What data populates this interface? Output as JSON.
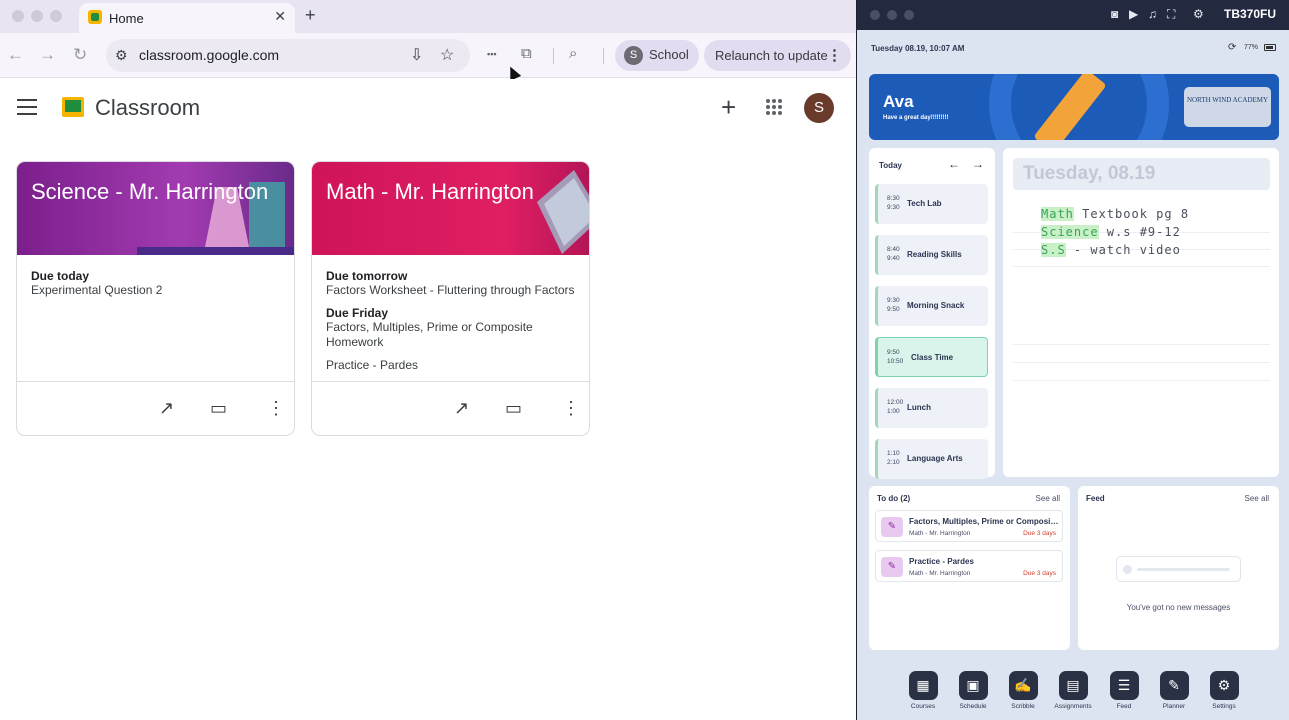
{
  "browser": {
    "tab": {
      "title": "Home"
    },
    "address_bar": {
      "url": "classroom.google.com"
    },
    "profile_chip": {
      "avatar_letter": "S",
      "label": "School"
    },
    "relaunch_button": {
      "label": "Relaunch to update"
    }
  },
  "classroom": {
    "app_title": "Classroom",
    "account_avatar_letter": "S",
    "courses": [
      {
        "title": "Science - Mr. Harrington",
        "banner_color": "#8e2a9e",
        "due": [
          {
            "label": "Due today",
            "text": "Experimental Question 2"
          }
        ]
      },
      {
        "title": "Math - Mr. Harrington",
        "banner_color": "#d81a5f",
        "due": [
          {
            "label": "Due tomorrow",
            "text": "Factors Worksheet - Fluttering through Factors"
          },
          {
            "label": "Due Friday",
            "text": "Factors, Multiples, Prime or Composite Homework"
          },
          {
            "label": "",
            "text": "Practice - Pardes"
          }
        ]
      }
    ]
  },
  "tablet": {
    "window_title": "TB370FU",
    "status": {
      "datetime": "Tuesday 08.19, 10:07 AM",
      "battery": "77%"
    },
    "hero": {
      "name": "Ava",
      "greeting": "Have a great day!!!!!!!!!",
      "school_logo_text": "NORTH WIND ACADEMY"
    },
    "schedule": {
      "header": "Today",
      "items": [
        {
          "start": "8:30",
          "end": "9:30",
          "label": "Tech Lab"
        },
        {
          "start": "8:40",
          "end": "9:40",
          "label": "Reading Skills"
        },
        {
          "start": "9:30",
          "end": "9:50",
          "label": "Morning Snack"
        },
        {
          "start": "9:50",
          "end": "10:50",
          "label": "Class Time",
          "active": true
        },
        {
          "start": "12:00",
          "end": "1:00",
          "label": "Lunch"
        },
        {
          "start": "1:10",
          "end": "2:10",
          "label": "Language Arts"
        }
      ]
    },
    "notes": {
      "date": "Tuesday, 08.19",
      "lines": [
        {
          "highlight": "Math",
          "rest": " Textbook pg 8"
        },
        {
          "highlight": "Science",
          "rest": " w.s #9-12"
        },
        {
          "highlight": "S.S",
          "rest": " - watch video"
        }
      ]
    },
    "todo": {
      "title": "To do (2)",
      "see_all": "See all",
      "items": [
        {
          "title": "Factors, Multiples, Prime or Composite Homework",
          "course": "Math - Mr. Harrington",
          "due": "Due 3 days"
        },
        {
          "title": "Practice - Pardes",
          "course": "Math - Mr. Harrington",
          "due": "Due 3 days"
        }
      ]
    },
    "feed": {
      "title": "Feed",
      "see_all": "See all",
      "empty_message": "You've got no new messages"
    },
    "dock": [
      "Courses",
      "Schedule",
      "Scribble",
      "Assignments",
      "Feed",
      "Planner",
      "Settings"
    ]
  }
}
